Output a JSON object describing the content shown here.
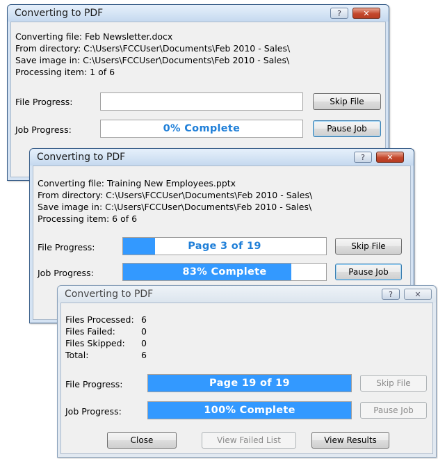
{
  "dialog1": {
    "title": "Converting to PDF",
    "help_glyph": "?",
    "close_glyph": "✕",
    "converting_file": "Converting file: Feb Newsletter.docx",
    "from_directory": "From directory: C:\\Users\\FCCUser\\Documents\\Feb 2010 - Sales\\",
    "save_image_in": "Save image in: C:\\Users\\FCCUser\\Documents\\Feb 2010 - Sales\\",
    "processing_item": "Processing item: 1 of 6",
    "file_progress_label": "File Progress:",
    "job_progress_label": "Job Progress:",
    "file_progress_text": "",
    "file_progress_fraction": 0,
    "job_progress_text": "0% Complete",
    "job_progress_fraction": 0,
    "skip_file_label": "Skip File",
    "pause_job_label": "Pause Job"
  },
  "dialog2": {
    "title": "Converting to PDF",
    "help_glyph": "?",
    "close_glyph": "✕",
    "converting_file": "Converting file: Training New Employees.pptx",
    "from_directory": "From directory: C:\\Users\\FCCUser\\Documents\\Feb 2010 - Sales\\",
    "save_image_in": "Save image in: C:\\Users\\FCCUser\\Documents\\Feb 2010 - Sales\\",
    "processing_item": "Processing item: 6 of 6",
    "file_progress_label": "File Progress:",
    "job_progress_label": "Job Progress:",
    "file_progress_text": "Page 3 of 19",
    "file_progress_fraction": 0.158,
    "job_progress_text": "83% Complete",
    "job_progress_fraction": 0.83,
    "skip_file_label": "Skip File",
    "pause_job_label": "Pause Job"
  },
  "dialog3": {
    "title": "Converting to PDF",
    "help_glyph": "?",
    "close_glyph": "✕",
    "stats": [
      {
        "label": "Files Processed:",
        "value": "6"
      },
      {
        "label": "Files Failed:",
        "value": "0"
      },
      {
        "label": "Files Skipped:",
        "value": "0"
      },
      {
        "label": "Total:",
        "value": "6"
      }
    ],
    "file_progress_label": "File Progress:",
    "job_progress_label": "Job Progress:",
    "file_progress_text": "Page 19 of 19",
    "file_progress_fraction": 1,
    "job_progress_text": "100% Complete",
    "job_progress_fraction": 1,
    "skip_file_label": "Skip File",
    "pause_job_label": "Pause Job",
    "close_label": "Close",
    "view_failed_label": "View Failed List",
    "view_results_label": "View Results"
  },
  "colors": {
    "progress_fill": "#3399ff",
    "progress_text": "#1f7fd8",
    "close_button": "#c4482d"
  }
}
